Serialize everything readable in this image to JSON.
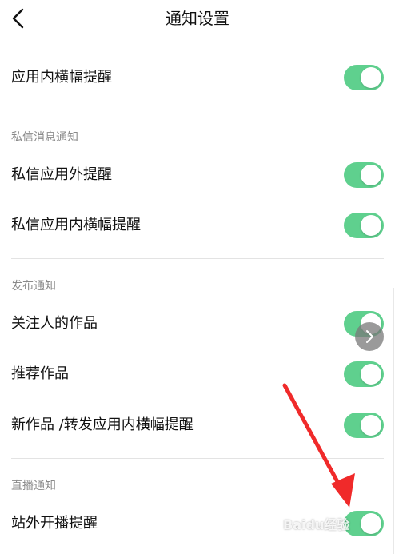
{
  "header": {
    "title": "通知设置",
    "back_icon": "chevron-left-icon"
  },
  "general": {
    "rows": [
      {
        "label": "应用内横幅提醒",
        "enabled": true
      }
    ]
  },
  "sections": [
    {
      "title": "私信消息通知",
      "rows": [
        {
          "label": "私信应用外提醒",
          "enabled": true
        },
        {
          "label": "私信应用内横幅提醒",
          "enabled": true
        }
      ]
    },
    {
      "title": "发布通知",
      "rows": [
        {
          "label": "关注人的作品",
          "enabled": true
        },
        {
          "label": "推荐作品",
          "enabled": true
        },
        {
          "label": "新作品 /转发应用内横幅提醒",
          "enabled": true
        }
      ]
    },
    {
      "title": "直播通知",
      "rows": [
        {
          "label": "站外开播提醒",
          "enabled": true
        }
      ]
    }
  ],
  "colors": {
    "toggle_on": "#5fd08e",
    "divider": "#e3e3e3",
    "section_text": "#8a8a8a",
    "annotation_arrow": "#f02a2a"
  },
  "overlay": {
    "float_button_icon": "chevron-right-icon",
    "annotation_icon": "red-arrow-icon",
    "watermark_text": "Baidu经验"
  }
}
